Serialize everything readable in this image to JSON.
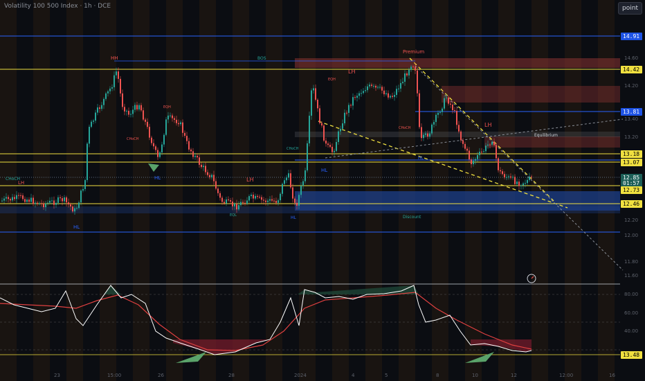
{
  "header": {
    "title": "Volatility 100 500 Index · 1h · DCE"
  },
  "toolbar": {
    "point_label": "point"
  },
  "price_axis": {
    "levels": [
      {
        "label": "14.91",
        "bg": "#1e53e5",
        "fg": "#ffffff"
      },
      {
        "label": "14.42",
        "bg": "#f0e040",
        "fg": "#000000"
      },
      {
        "label": "13.81",
        "bg": "#1e53e5",
        "fg": "#ffffff"
      },
      {
        "label": "13.18",
        "bg": "#f0e040",
        "fg": "#000000"
      },
      {
        "label": "13.07",
        "bg": "#f0e040",
        "fg": "#000000"
      },
      {
        "label": "12.85",
        "bg": "#1d5f58",
        "fg": "#ffffff"
      },
      {
        "label": "01:57",
        "bg": "#1d5f58",
        "fg": "#ffffff"
      },
      {
        "label": "12.73",
        "bg": "#f0e040",
        "fg": "#000000"
      },
      {
        "label": "12.46",
        "bg": "#f0e040",
        "fg": "#000000"
      },
      {
        "label": "13.48",
        "bg": "#f0e040",
        "fg": "#000000"
      }
    ],
    "faint_ticks": [
      "14.60",
      "14.20",
      "13.40",
      "13.20",
      "12.20",
      "12.00",
      "11.80",
      "11.60"
    ],
    "osc_ticks": [
      "80.00",
      "60.00",
      "40.00"
    ]
  },
  "time_axis": [
    "23",
    "15:00",
    "26",
    "28",
    "2024",
    "4",
    "5",
    "8",
    "10",
    "12",
    "12:00",
    "16"
  ],
  "annotations": {
    "hh": "HH",
    "bos": "BOS",
    "premium": "Premium",
    "lh": "LH",
    "hl": "HL",
    "equilibrium": "Equilibrium",
    "discount": "Discount",
    "choch": "CHoCH",
    "eqh": "EQH",
    "eql": "EQL"
  },
  "colors": {
    "bull": "#26a69a",
    "bear": "#ef5350",
    "yellow": "#f0e040",
    "blue": "#2962ff",
    "premium": "#a33a3a",
    "discount": "#1e3f8a",
    "osc_line": "#ffffff",
    "osc_signal": "#e04040"
  },
  "icons": {
    "alert": "alert-clock-icon",
    "arrow": "green-arrow-icon"
  }
}
